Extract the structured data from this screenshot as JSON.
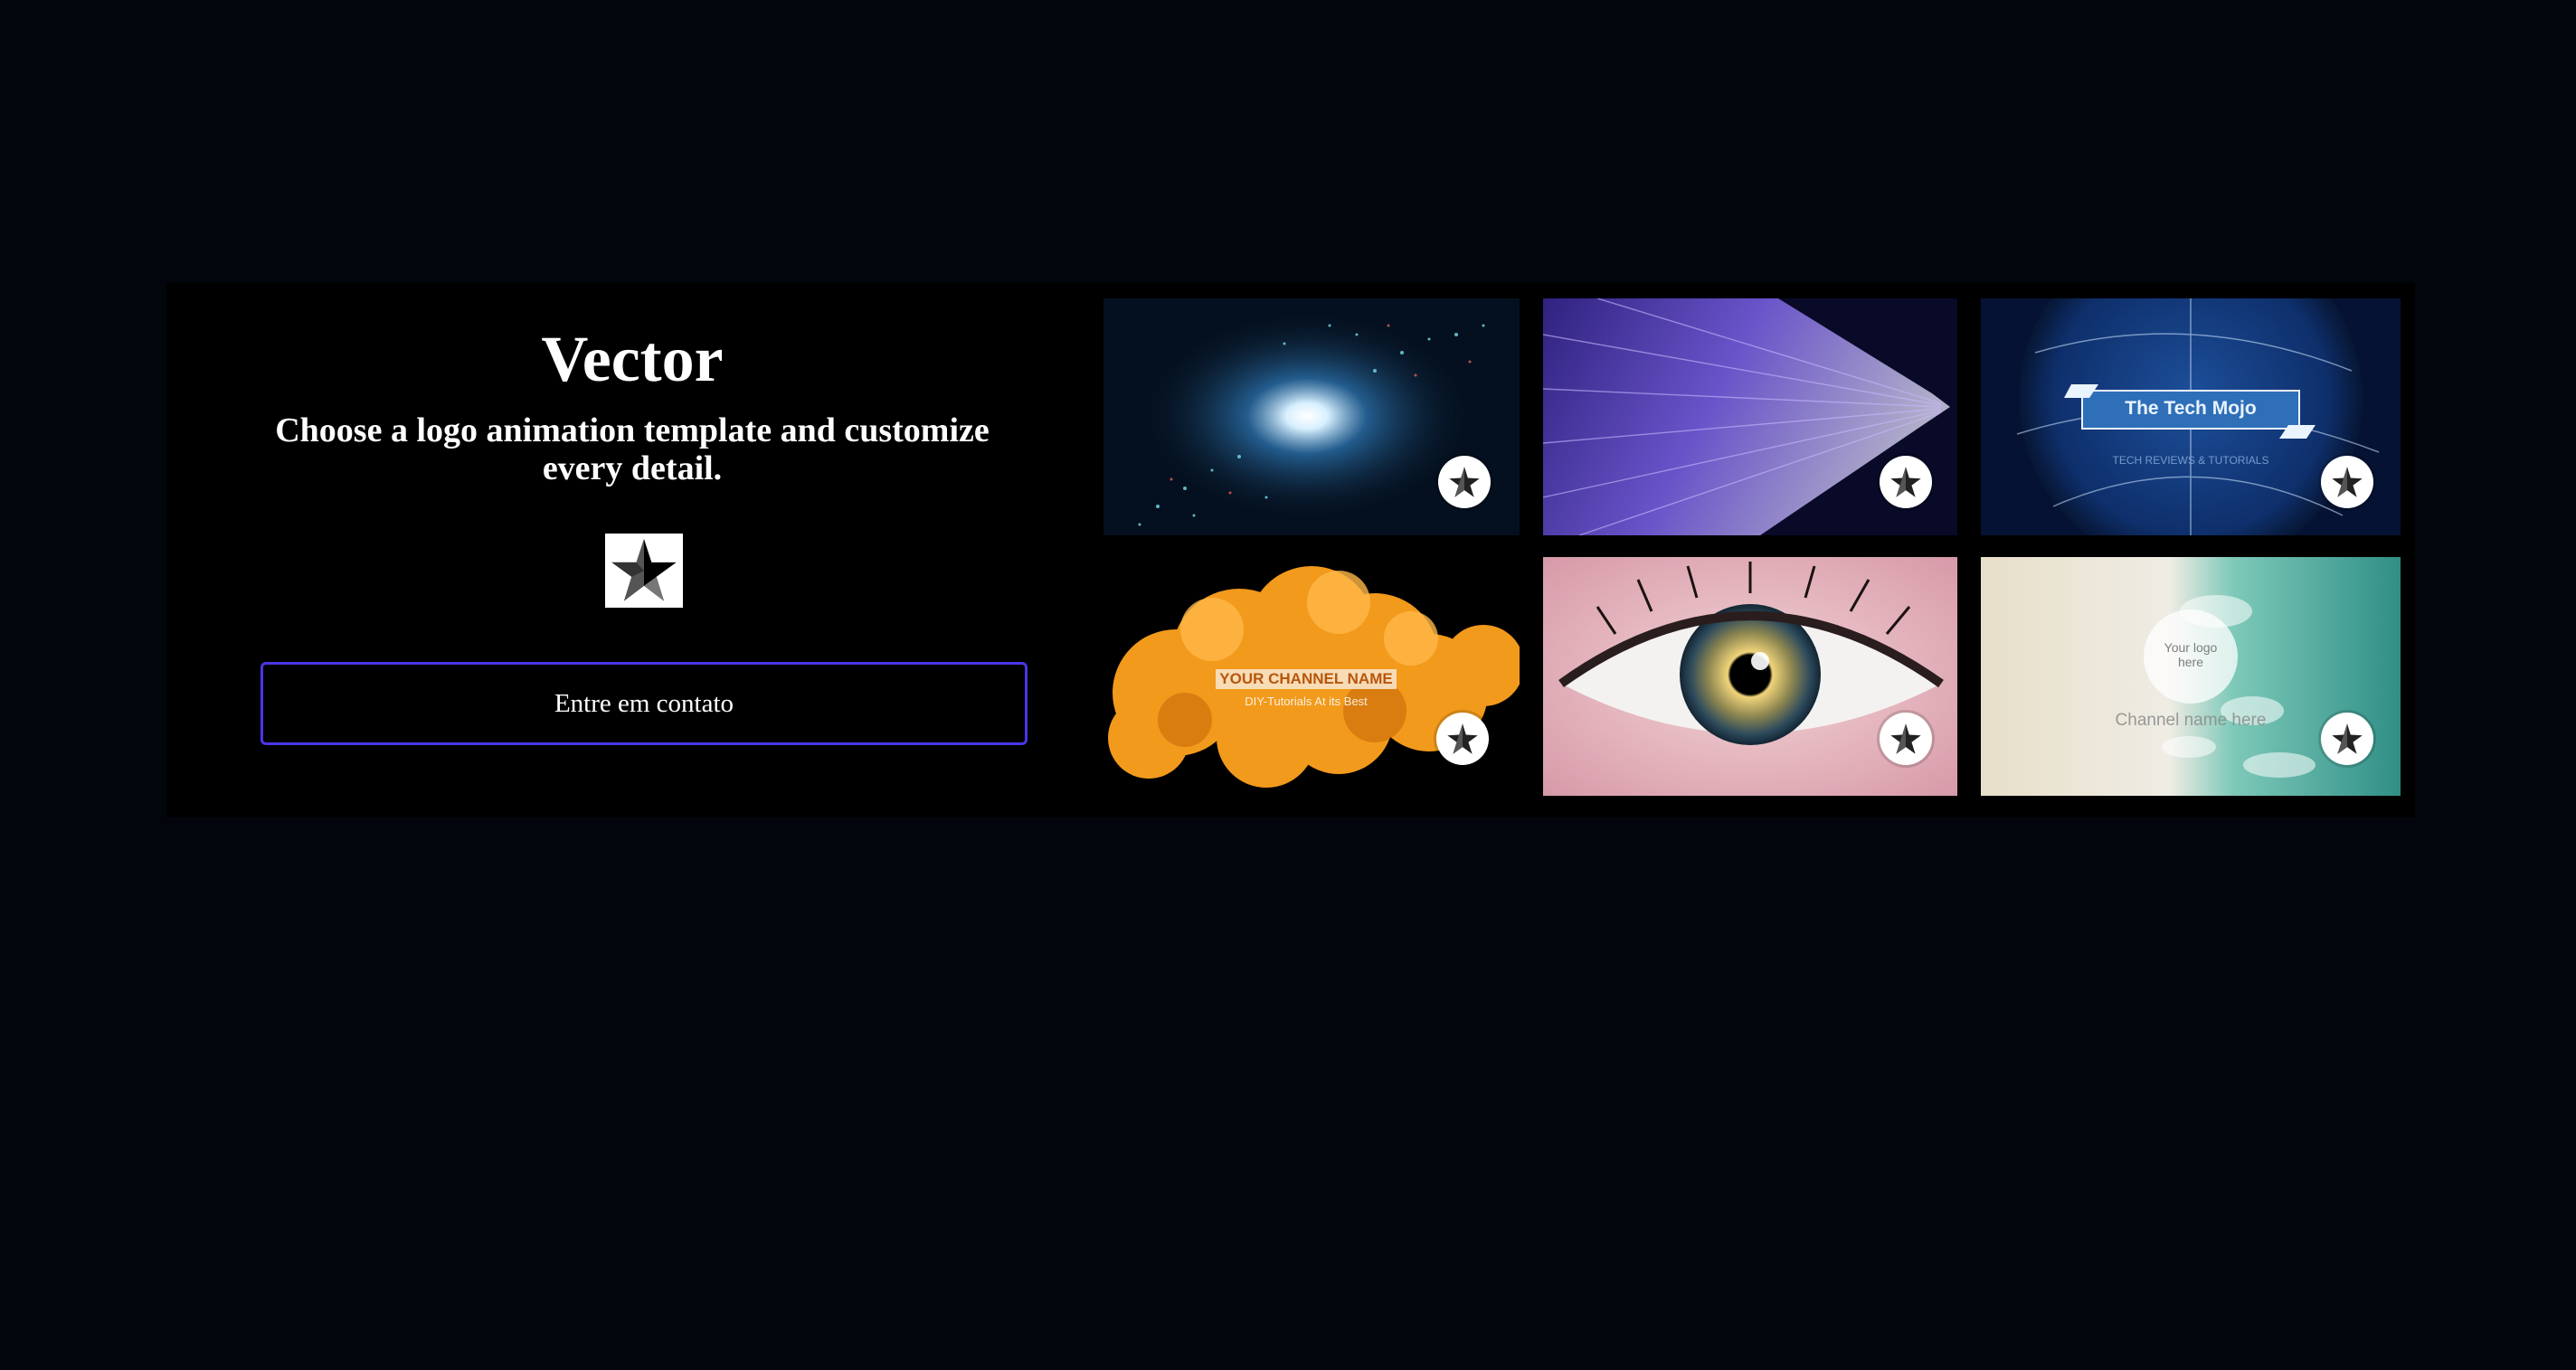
{
  "hero": {
    "title": "Vector",
    "subtitle": "Choose a logo animation template and customize every detail.",
    "logo_icon": "star-icon",
    "contact_button": "Entre em contato"
  },
  "colors": {
    "page_background": "#03050d",
    "card_background": "#000000",
    "button_border": "#4a36e8",
    "text": "#ffffff"
  },
  "templates": [
    {
      "name": "Particle Galaxy",
      "badge_icon": "star-icon"
    },
    {
      "name": "Purple Particle Stream",
      "badge_icon": "star-icon"
    },
    {
      "name": "Globe Network",
      "badge_icon": "star-icon",
      "overlay_title": "The Tech Mojo",
      "overlay_sub": "TECH REVIEWS & TUTORIALS"
    },
    {
      "name": "Orange Ink Smoke",
      "badge_icon": "star-icon",
      "overlay_title": "YOUR CHANNEL NAME",
      "overlay_sub": "DIY-Tutorials At its Best"
    },
    {
      "name": "Eye Close-up",
      "badge_icon": "star-icon"
    },
    {
      "name": "Ocean Wave",
      "badge_icon": "star-icon",
      "overlay_title": "Your logo here",
      "overlay_sub": "Channel name here"
    }
  ]
}
